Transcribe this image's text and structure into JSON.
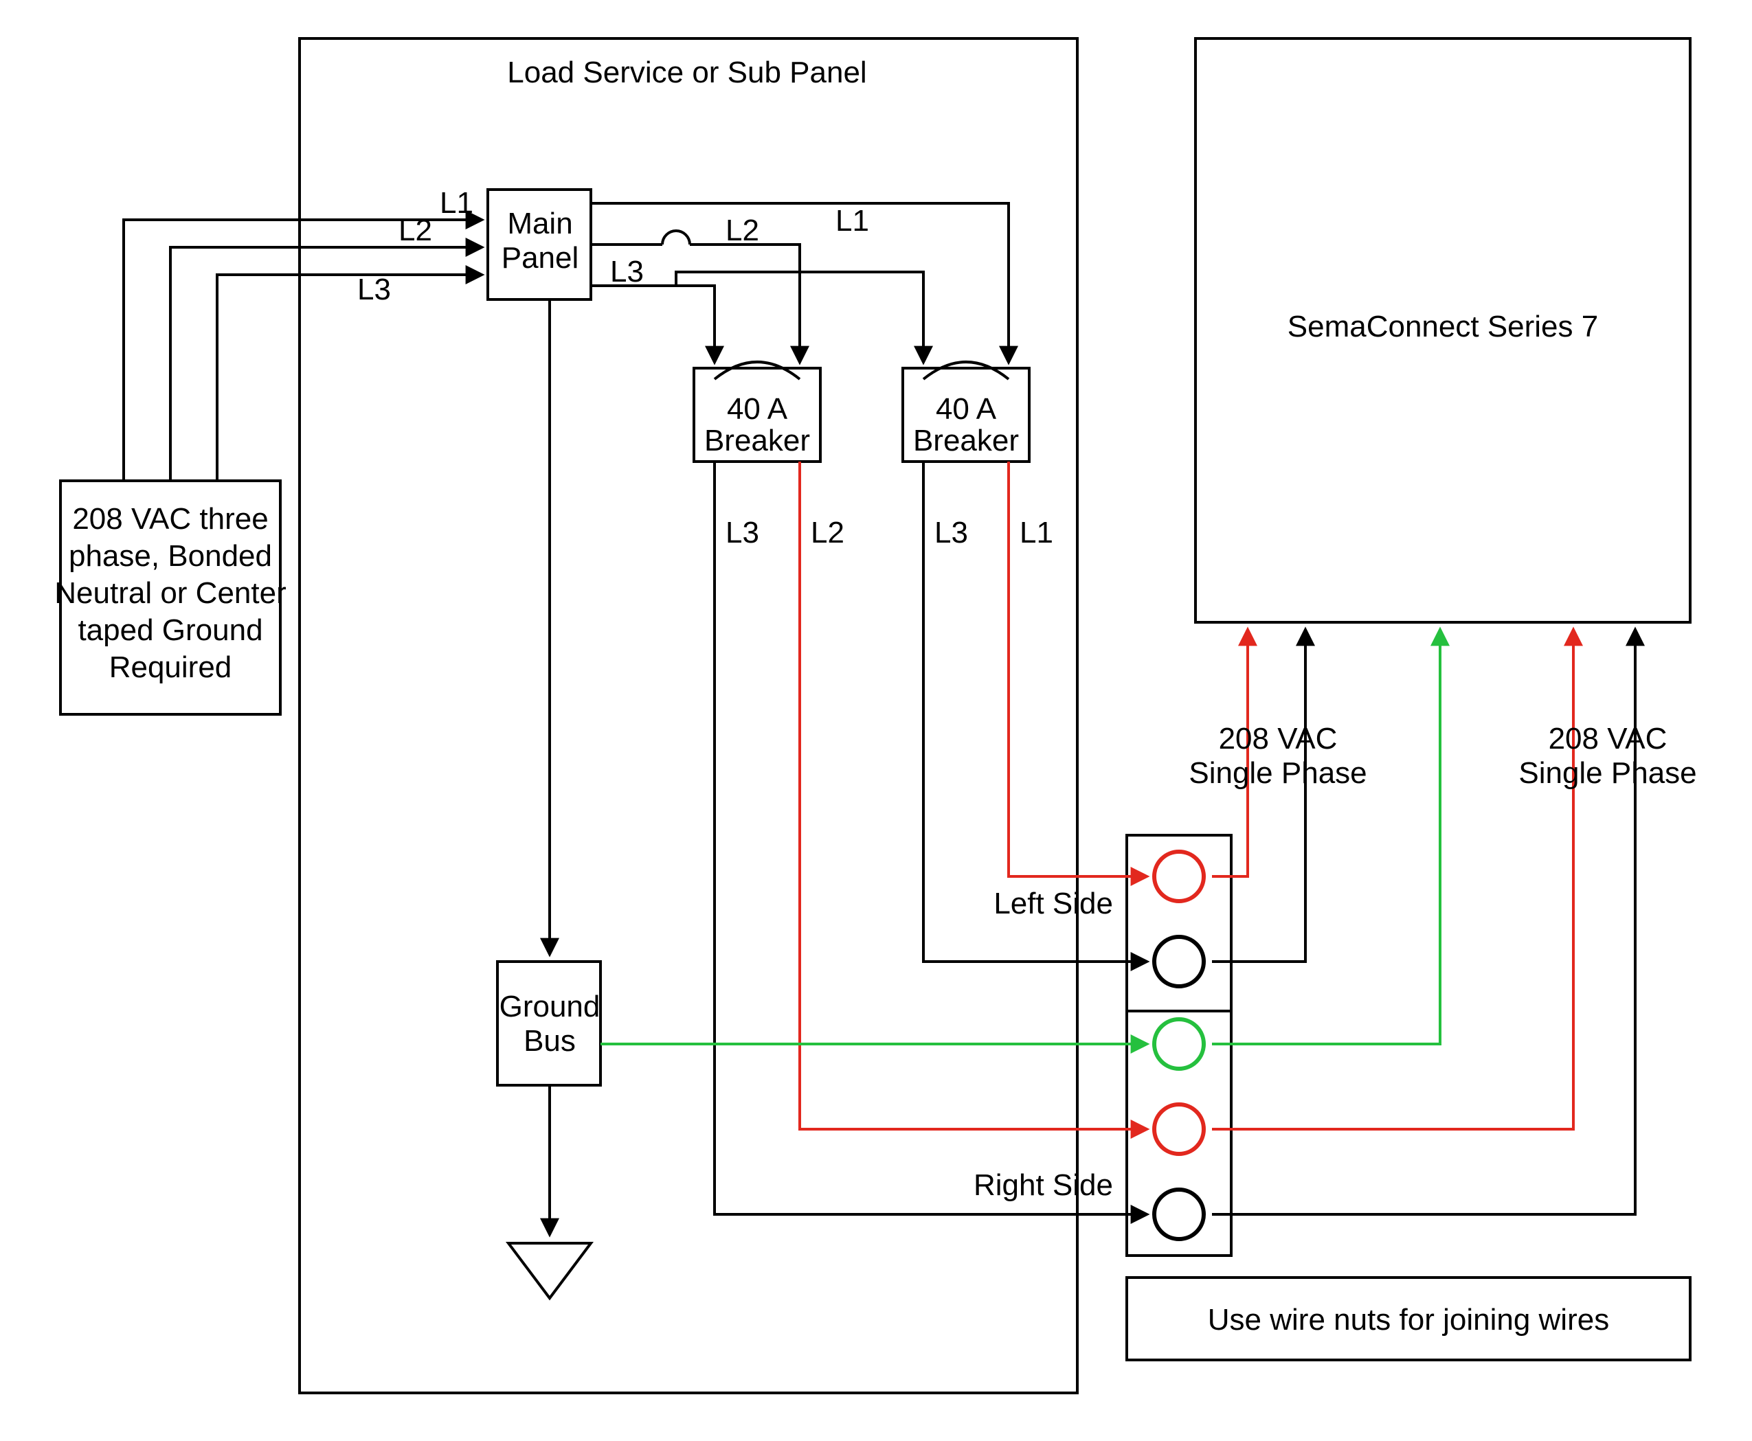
{
  "colors": {
    "red": "#e2281e",
    "green": "#25c03e",
    "black": "#000000"
  },
  "title": "Load Service or Sub Panel",
  "power_source": [
    "208 VAC three",
    "phase, Bonded",
    "Neutral or Center",
    "taped Ground",
    "Required"
  ],
  "main_panel": [
    "Main",
    "Panel"
  ],
  "breaker1": [
    "40 A",
    "Breaker"
  ],
  "breaker2": [
    "40 A",
    "Breaker"
  ],
  "ground_bus": [
    "Ground",
    "Bus"
  ],
  "sema": "SemaConnect Series 7",
  "left_side": "Left Side",
  "right_side": "Right Side",
  "phase_label1": [
    "208 VAC",
    "Single Phase"
  ],
  "phase_label2": [
    "208 VAC",
    "Single Phase"
  ],
  "wire_note": "Use wire nuts for joining wires",
  "L1": "L1",
  "L2": "L2",
  "L3": "L3"
}
